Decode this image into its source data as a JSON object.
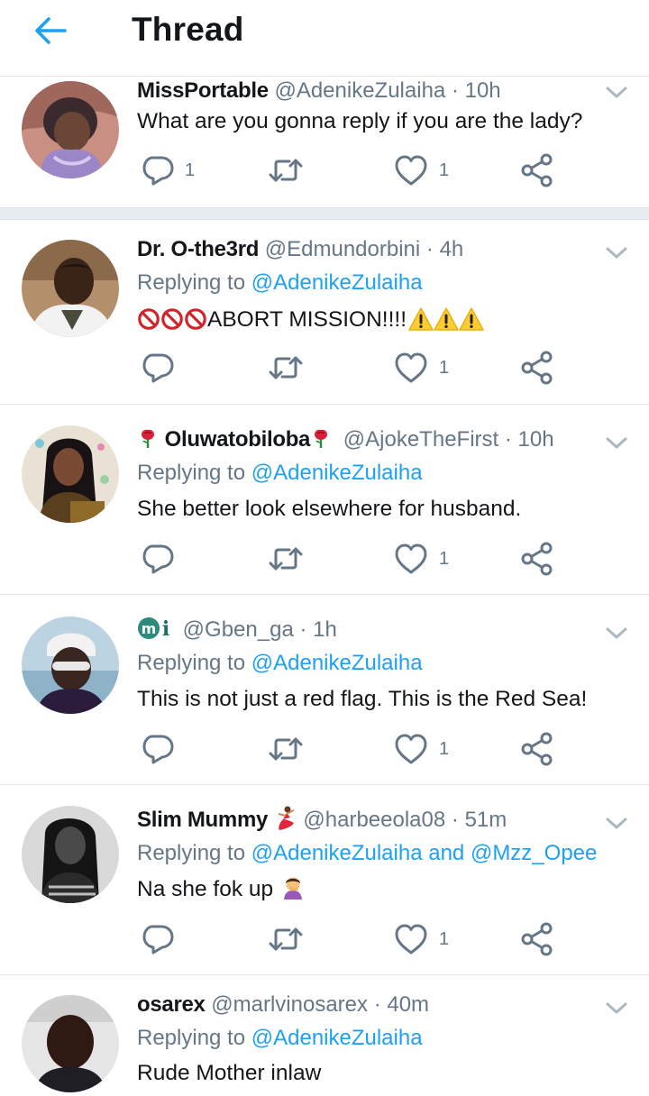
{
  "header": {
    "title": "Thread"
  },
  "tweets": [
    {
      "name": "MissPortable",
      "handle": "@AdenikeZulaiha",
      "dot": "·",
      "time": "10h",
      "text": "What are you gonna reply if you are the lady?",
      "reply_count": "1",
      "like_count": "1"
    },
    {
      "name": "Dr. O-the3rd",
      "handle": "@Edmundorbini",
      "dot": "·",
      "time": "4h",
      "replying_prefix": "Replying to ",
      "replying_to": "@AdenikeZulaiha",
      "text": "ABORT MISSION!!!!",
      "like_count": "1"
    },
    {
      "name": "Oluwatobiloba",
      "handle": "@AjokeTheFirst",
      "dot": "·",
      "time": "10h",
      "replying_prefix": "Replying to ",
      "replying_to": "@AdenikeZulaiha",
      "text": "She better look elsewhere for husband.",
      "like_count": "1"
    },
    {
      "name": "",
      "handle": "@Gben_ga",
      "dot": "·",
      "time": "1h",
      "replying_prefix": "Replying to ",
      "replying_to": "@AdenikeZulaiha",
      "text": "This is not just a red flag. This is the Red Sea!",
      "like_count": "1"
    },
    {
      "name": "Slim Mummy",
      "handle": "@harbeeola08",
      "dot": "·",
      "time": "51m",
      "replying_prefix": "Replying to ",
      "replying_to": "@AdenikeZulaiha",
      "replying_and": " and ",
      "replying_to_2": "@Mzz_Opee",
      "text": "Na she fok up",
      "like_count": "1"
    },
    {
      "name": "osarex",
      "handle": "@marlvinosarex",
      "dot": "·",
      "time": "40m",
      "replying_prefix": "Replying to ",
      "replying_to": "@AdenikeZulaiha",
      "text": "Rude Mother inlaw"
    }
  ],
  "colors": {
    "accent": "#1da1f2",
    "muted": "#657786",
    "text": "#14171a",
    "divider": "#e1e8ed"
  },
  "icons": [
    "back-arrow-icon",
    "chevron-down-icon",
    "reply-icon",
    "retweet-icon",
    "like-icon",
    "share-icon",
    "rose-icon",
    "no-entry-icon",
    "warning-icon",
    "dancer-icon",
    "facepalm-icon",
    "mi-logo-icon"
  ]
}
